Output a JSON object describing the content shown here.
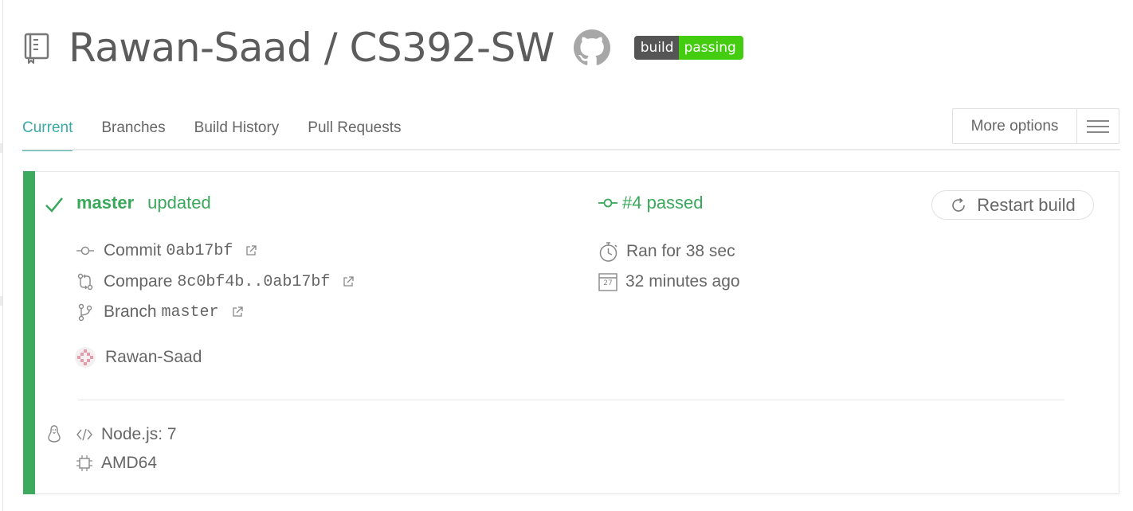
{
  "repo": {
    "owner": "Rawan-Saad",
    "separator": " / ",
    "name": "CS392-SW",
    "badge": {
      "left": "build",
      "right": "passing",
      "left_color": "#555555",
      "right_color": "#44cc11"
    }
  },
  "tabs": [
    {
      "label": "Current",
      "active": true
    },
    {
      "label": "Branches"
    },
    {
      "label": "Build History"
    },
    {
      "label": "Pull Requests"
    }
  ],
  "more_options": {
    "label": "More options",
    "icon": "hamburger-icon"
  },
  "build": {
    "status_color": "#3eaa5e",
    "branch": "master",
    "branch_status": "updated",
    "number_status": "#4 passed",
    "restart_label": "Restart build",
    "commit_label": "Commit",
    "commit_sha": "0ab17bf",
    "compare_label": "Compare",
    "compare_range": "8c0bf4b..0ab17bf",
    "branch_label": "Branch",
    "branch_value": "master",
    "author": "Rawan-Saad",
    "duration": "Ran for 38 sec",
    "finished": "32 minutes ago",
    "calendar_day": "27",
    "language": "Node.js: 7",
    "arch": "AMD64"
  }
}
